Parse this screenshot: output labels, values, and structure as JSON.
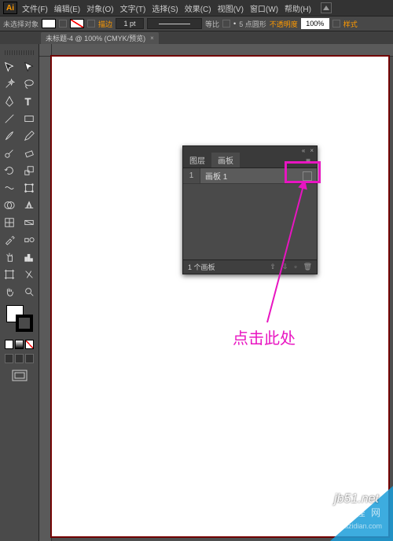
{
  "app": {
    "logo": "Ai"
  },
  "menu": {
    "file": "文件(F)",
    "edit": "编辑(E)",
    "object": "对象(O)",
    "type": "文字(T)",
    "select": "选择(S)",
    "effect": "效果(C)",
    "view": "视图(V)",
    "window": "窗口(W)",
    "help": "帮助(H)"
  },
  "opt": {
    "noSelection": "未选择对象",
    "strokeLabel": "描边",
    "strokeValue": "1 pt",
    "uniformLabel": "等比",
    "brushLabel": "5 点圆形",
    "opacityLabel": "不透明度",
    "opacityValue": "100%",
    "styleLabel": "样式"
  },
  "doc": {
    "tabTitle": "未标题-4 @ 100% (CMYK/预览)"
  },
  "panel": {
    "tabLayers": "图层",
    "tabArtboards": "画板",
    "row": {
      "index": "1",
      "name": "画板 1"
    },
    "footer": "1 个画板"
  },
  "annotation": {
    "text": "点击此处"
  },
  "watermark": {
    "site": "jb51.net",
    "brand": "智 勇 典 教 程 网",
    "url": "jiaocheng.chazidian.com"
  }
}
